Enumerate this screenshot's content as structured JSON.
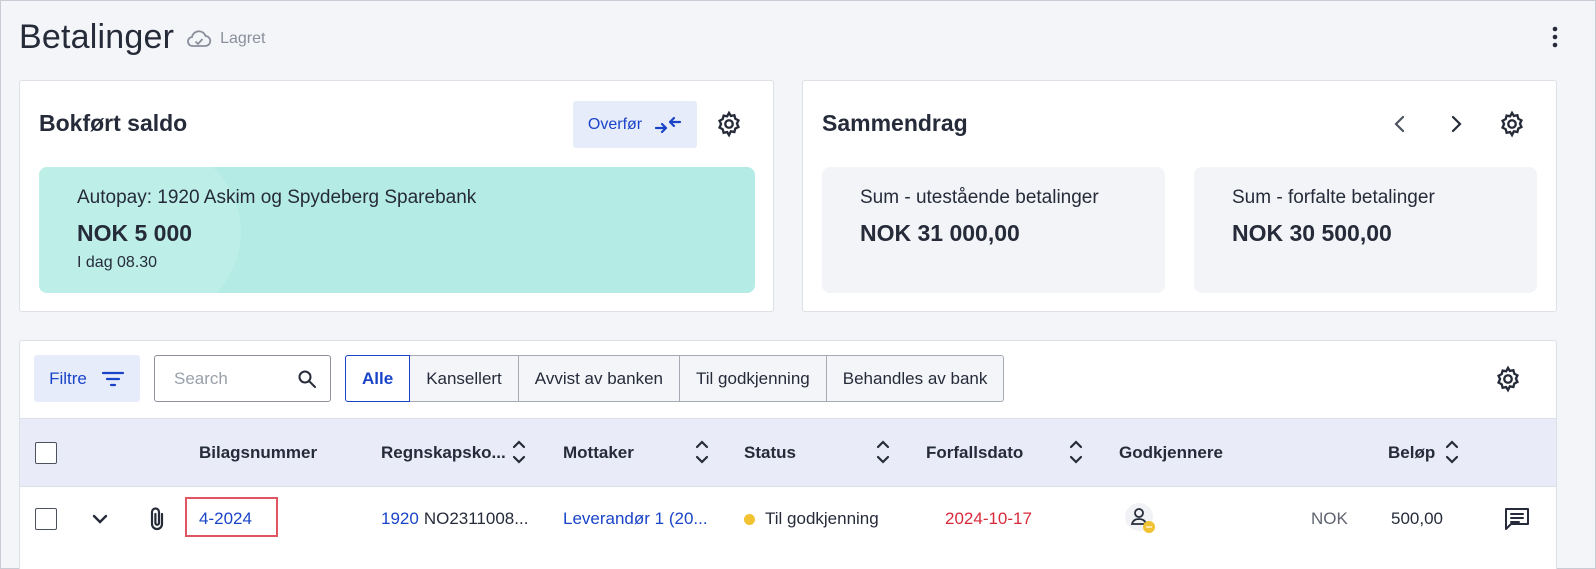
{
  "page": {
    "title": "Betalinger",
    "saved_label": "Lagret"
  },
  "balance_card": {
    "title": "Bokført saldo",
    "transfer_label": "Overfør",
    "bank_name": "Autopay: 1920 Askim og Spydeberg Sparebank",
    "bank_amount": "NOK 5 000",
    "bank_time": "I dag 08.30"
  },
  "summary_card": {
    "title": "Sammendrag",
    "tiles": [
      {
        "label": "Sum - utestående betalinger",
        "value": "NOK 31 000,00"
      },
      {
        "label": "Sum - forfalte betalinger",
        "value": "NOK 30 500,00"
      }
    ]
  },
  "toolbar": {
    "filter_label": "Filtre",
    "search_placeholder": "Search",
    "tabs": [
      "Alle",
      "Kansellert",
      "Avvist av banken",
      "Til godkjenning",
      "Behandles av bank"
    ]
  },
  "table": {
    "columns": {
      "voucher": "Bilagsnummer",
      "account": "Regnskapsko...",
      "recipient": "Mottaker",
      "status": "Status",
      "due_date": "Forfallsdato",
      "approvers": "Godkjennere",
      "amount": "Beløp"
    },
    "rows": [
      {
        "voucher": "4-2024",
        "account_no": "1920",
        "account_iban": "NO2311008...",
        "recipient": "Leverandør 1 (20...",
        "status": "Til godkjenning",
        "due_date": "2024-10-17",
        "currency": "NOK",
        "amount": "500,00"
      }
    ]
  },
  "colors": {
    "accent": "#1a44c8",
    "bank_tile": "#b5ebe5",
    "status_pending": "#f1c232",
    "overdue": "#d82a3a",
    "highlight": "#e05561"
  }
}
